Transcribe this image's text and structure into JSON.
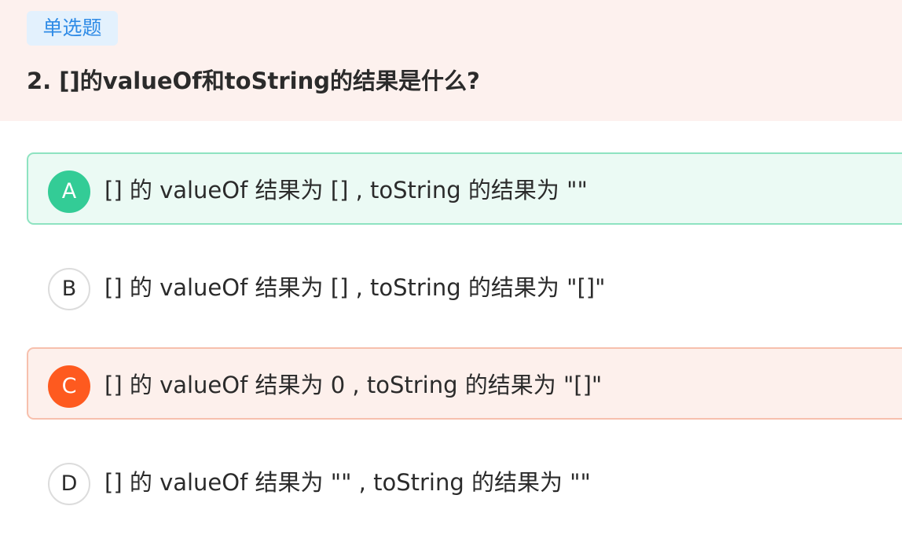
{
  "question": {
    "type_label": "单选题",
    "title": "2. []的valueOf和toString的结果是什么?"
  },
  "options": [
    {
      "letter": "A",
      "text": "[] 的 valueOf 结果为 [] ,  toString 的结果为 \"\"",
      "state": "correct"
    },
    {
      "letter": "B",
      "text": "[] 的 valueOf 结果为 [] ,  toString 的结果为 \"[]\"",
      "state": "default"
    },
    {
      "letter": "C",
      "text": "[] 的 valueOf 结果为 0 ,  toString 的结果为 \"[]\"",
      "state": "wrong"
    },
    {
      "letter": "D",
      "text": "[] 的 valueOf 结果为 \"\" ,  toString 的结果为 \"\"",
      "state": "default"
    }
  ],
  "colors": {
    "header_bg": "#fdf1ee",
    "badge_bg": "#e3f1fd",
    "badge_text": "#2f8be6",
    "correct": "#33cc96",
    "wrong": "#fe5a1f"
  }
}
